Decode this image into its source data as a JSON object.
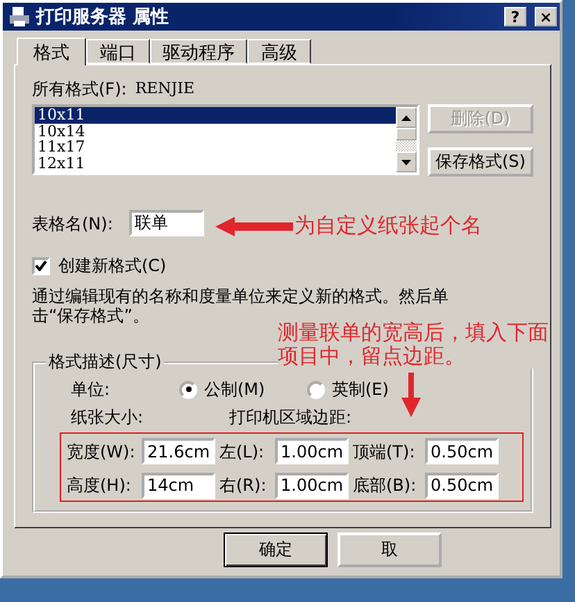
{
  "window": {
    "title": "打印服务器 属性",
    "help_button": "?",
    "close_button": "×"
  },
  "tabs": [
    {
      "label": "格式",
      "selected": true
    },
    {
      "label": "端口",
      "selected": false
    },
    {
      "label": "驱动程序",
      "selected": false
    },
    {
      "label": "高级",
      "selected": false
    }
  ],
  "formats": {
    "label": "所有格式(F):",
    "server": "RENJIE",
    "items": [
      {
        "label": "10x11",
        "selected": true
      },
      {
        "label": "10x14",
        "selected": false
      },
      {
        "label": "11x17",
        "selected": false
      },
      {
        "label": "12x11",
        "selected": false
      }
    ]
  },
  "side_buttons": [
    {
      "label": "删除(D)",
      "disabled": true
    },
    {
      "label": "保存格式(S)",
      "disabled": false
    }
  ],
  "form_name": {
    "label": "表格名(N):",
    "value": "联单"
  },
  "create_new": {
    "label": "创建新格式(C)",
    "checked": true
  },
  "description": "通过编辑现有的名称和度量单位来定义新的格式。然后单击“保存格式”。",
  "group": {
    "title": "格式描述(尺寸)",
    "unit_label": "单位:",
    "units": [
      {
        "label": "公制(M)",
        "selected": true
      },
      {
        "label": "英制(E)",
        "selected": false
      }
    ],
    "paper_size_label": "纸张大小:",
    "margins_label": "打印机区域边距:",
    "fields": [
      {
        "label": "宽度(W):",
        "value": "21.6cm"
      },
      {
        "label": "左(L):",
        "value": "1.00cm"
      },
      {
        "label": "顶端(T):",
        "value": "0.50cm"
      },
      {
        "label": "高度(H):",
        "value": "14cm"
      },
      {
        "label": "右(R):",
        "value": "1.00cm"
      },
      {
        "label": "底部(B):",
        "value": "0.50cm"
      }
    ]
  },
  "footer_buttons": [
    "确定",
    "取"
  ],
  "annotations": [
    {
      "lines": [
        "为自定义纸张起个名"
      ]
    },
    {
      "lines": [
        "测量联单的宽高后，填入下面",
        "项目中，留点边距。"
      ]
    }
  ]
}
